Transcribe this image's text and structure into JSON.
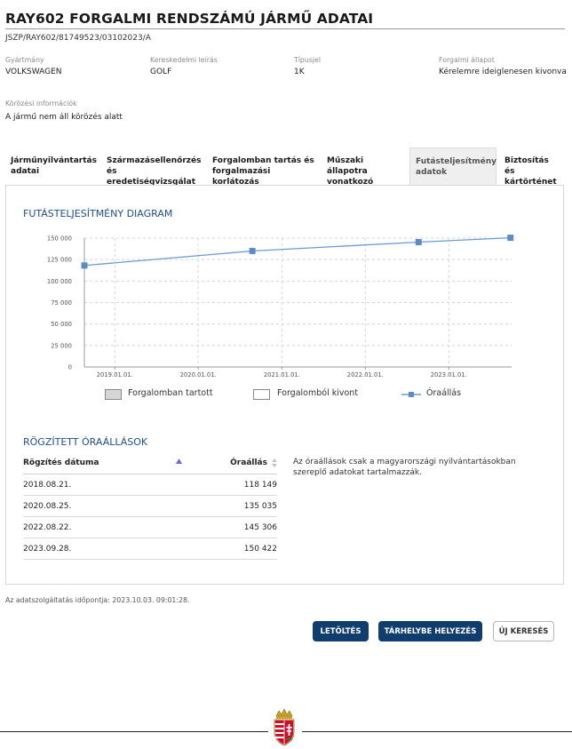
{
  "page": {
    "title": "RAY602 FORGALMI RENDSZÁMÚ JÁRMŰ ADATAI",
    "reference": "JSZP/RAY602/81749523/03102023/A"
  },
  "vehicle": {
    "make_label": "Gyártmány",
    "make_value": "VOLKSWAGEN",
    "trade_label": "Kereskedelmi leírás",
    "trade_value": "GOLF",
    "type_label": "Típusjel",
    "type_value": "1K",
    "status_label": "Forgalmi állapot",
    "status_value": "Kérelemre ideiglenesen kivonva",
    "wanted_label": "Körözési információk",
    "wanted_value": "A jármű nem áll körözés alatt"
  },
  "tabs": [
    {
      "line1": "Járműnyilvántartás",
      "line2": "adatai"
    },
    {
      "line1": "Származásellenőrzés",
      "line2": "és eredetiségvizsgálat"
    },
    {
      "line1": "Forgalomban tartás és",
      "line2": "forgalmazási korlátozás"
    },
    {
      "line1": "Műszaki állapotra",
      "line2": "vonatkozó adatok"
    },
    {
      "line1": "Futásteljesítmény",
      "line2": "adatok"
    },
    {
      "line1": "Biztosítás és",
      "line2": "kártörténet"
    }
  ],
  "active_tab": 4,
  "chart_section": {
    "title": "FUTÁSTELJESÍTMÉNY DIAGRAM"
  },
  "chart_data": {
    "type": "line",
    "title": "FUTÁSTELJESÍTMÉNY DIAGRAM",
    "xlabel": "",
    "ylabel": "",
    "x_ticks": [
      "2019.01.01.",
      "2020.01.01.",
      "2021.01.01.",
      "2022.01.01.",
      "2023.01.01."
    ],
    "y_ticks": [
      "150 000",
      "125 000",
      "100 000",
      "75 000",
      "50 000",
      "25 000",
      "0"
    ],
    "ylim": [
      0,
      150000
    ],
    "xlim": [
      "2018.08.21.",
      "2023.10.03."
    ],
    "grid": true,
    "series": [
      {
        "name": "Óraállás",
        "x": [
          "2018.08.21.",
          "2020.08.25.",
          "2022.08.22.",
          "2023.09.28."
        ],
        "values": [
          118149,
          135035,
          145306,
          150422
        ],
        "color": "#6b9ad1"
      }
    ],
    "legend": [
      "Forgalomban tartott",
      "Forgalomból kivont",
      "Óraállás"
    ],
    "legend_position": "bottom"
  },
  "records": {
    "title": "RÖGZÍTETT ÓRAÁLLÁSOK",
    "col_date": "Rögzítés dátuma",
    "col_value": "Óraállás",
    "rows": [
      {
        "date": "2018.08.21.",
        "value": "118 149"
      },
      {
        "date": "2020.08.25.",
        "value": "135 035"
      },
      {
        "date": "2022.08.22.",
        "value": "145 306"
      },
      {
        "date": "2023.09.28.",
        "value": "150 422"
      }
    ],
    "note": "Az óraállások csak a magyarországi nyilvántartásokban szereplő adatokat tartalmazzák."
  },
  "footer": {
    "timestamp": "Az adatszolgáltatás időpontja: 2023.10.03. 09:01:28.",
    "download_label": "LETÖLTÉS",
    "store_label": "TÁRHELYBE HELYEZÉS",
    "new_search_label": "ÚJ KERESÉS"
  },
  "colors": {
    "accent": "#1f4e8c",
    "button_primary": "#0f3d6e",
    "series_line": "#6b9ad1",
    "series_marker": "#5b8cc8"
  },
  "icons": {
    "legend_line": "line-marker-icon",
    "coat_of_arms": "hungarian-coat-of-arms-icon",
    "sort_up": "sort-arrow-up-icon",
    "sort_both": "sort-arrows-icon"
  }
}
